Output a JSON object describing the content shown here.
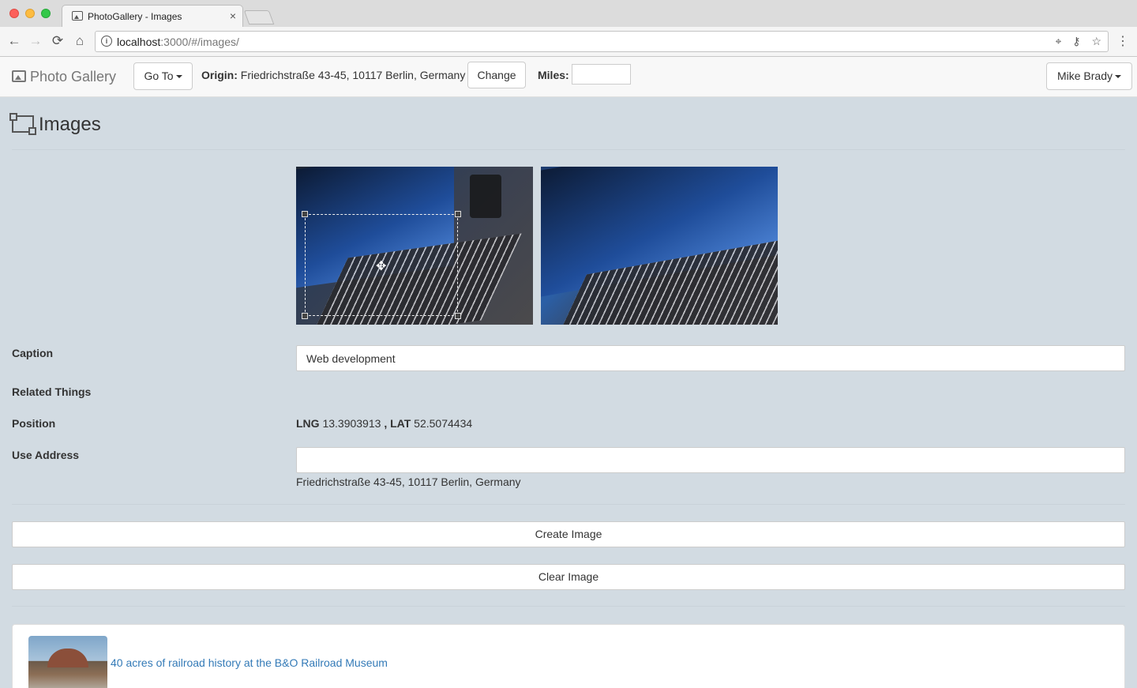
{
  "browser": {
    "tab_title": "PhotoGallery - Images",
    "tab_close": "×",
    "url_host": "localhost",
    "url_path": ":3000/#/images/",
    "icons": {
      "back": "←",
      "forward": "→",
      "reload": "⟳",
      "home": "⌂",
      "info": "i",
      "location": "⌖",
      "key": "⚷",
      "star": "☆",
      "menu": "⋮"
    }
  },
  "navbar": {
    "brand": "Photo Gallery",
    "goto_label": "Go To",
    "origin_label": "Origin:",
    "origin_value": "Friedrichstraße 43-45, 10117 Berlin, Germany",
    "change_label": "Change",
    "miles_label": "Miles:",
    "miles_value": "",
    "user_label": "Mike Brady"
  },
  "page": {
    "title": "Images"
  },
  "form": {
    "caption_label": "Caption",
    "caption_value": "Web development",
    "related_label": "Related Things",
    "position_label": "Position",
    "lng_label": "LNG",
    "lng_value": "13.3903913",
    "position_sep": ",",
    "lat_label": "LAT",
    "lat_value": "52.5074434",
    "address_label": "Use Address",
    "address_value": "",
    "address_text": "Friedrichstraße 43-45, 10117 Berlin, Germany",
    "move_icon": "✥"
  },
  "actions": {
    "create_label": "Create Image",
    "clear_label": "Clear Image"
  },
  "image_list": [
    {
      "caption": "40 acres of railroad history at the B&O Railroad Museum"
    }
  ]
}
